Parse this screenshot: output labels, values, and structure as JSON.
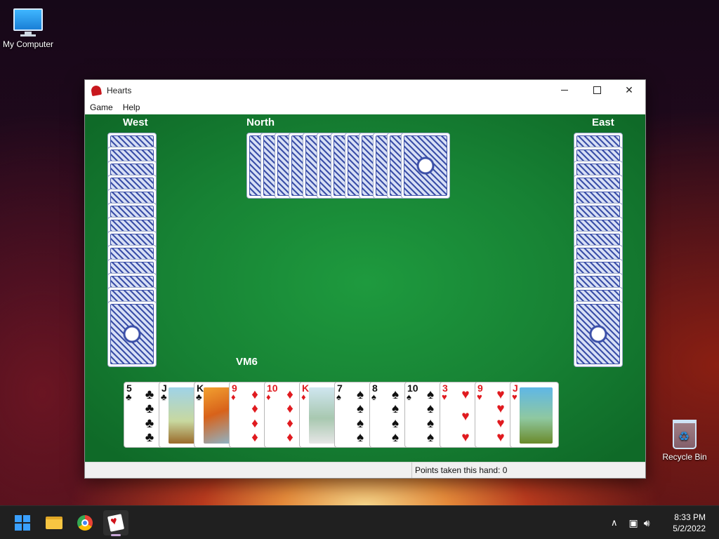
{
  "desktop": {
    "icons": {
      "my_computer": "My Computer",
      "recycle_bin": "Recycle Bin"
    }
  },
  "window": {
    "title": "Hearts",
    "menu": [
      "Game",
      "Help"
    ]
  },
  "game": {
    "players": {
      "west": "West",
      "north": "North",
      "east": "East",
      "south": "VM6"
    },
    "hand": [
      {
        "rank": "5",
        "suit": "clubs"
      },
      {
        "rank": "J",
        "suit": "clubs"
      },
      {
        "rank": "K",
        "suit": "clubs"
      },
      {
        "rank": "9",
        "suit": "diamonds"
      },
      {
        "rank": "10",
        "suit": "diamonds"
      },
      {
        "rank": "K",
        "suit": "diamonds"
      },
      {
        "rank": "7",
        "suit": "spades"
      },
      {
        "rank": "8",
        "suit": "spades"
      },
      {
        "rank": "10",
        "suit": "spades"
      },
      {
        "rank": "3",
        "suit": "hearts"
      },
      {
        "rank": "9",
        "suit": "hearts"
      },
      {
        "rank": "J",
        "suit": "hearts"
      }
    ],
    "colors": {
      "felt": "#178234",
      "card_back": "#3b4fa8",
      "red_suit": "#e01a1f"
    }
  },
  "status": {
    "points": "Points taken this hand: 0"
  },
  "taskbar": {
    "time": "8:33 PM",
    "date": "5/2/2022",
    "apps": [
      "start-icon",
      "file-explorer-icon",
      "chrome-icon",
      "hearts-icon"
    ]
  }
}
